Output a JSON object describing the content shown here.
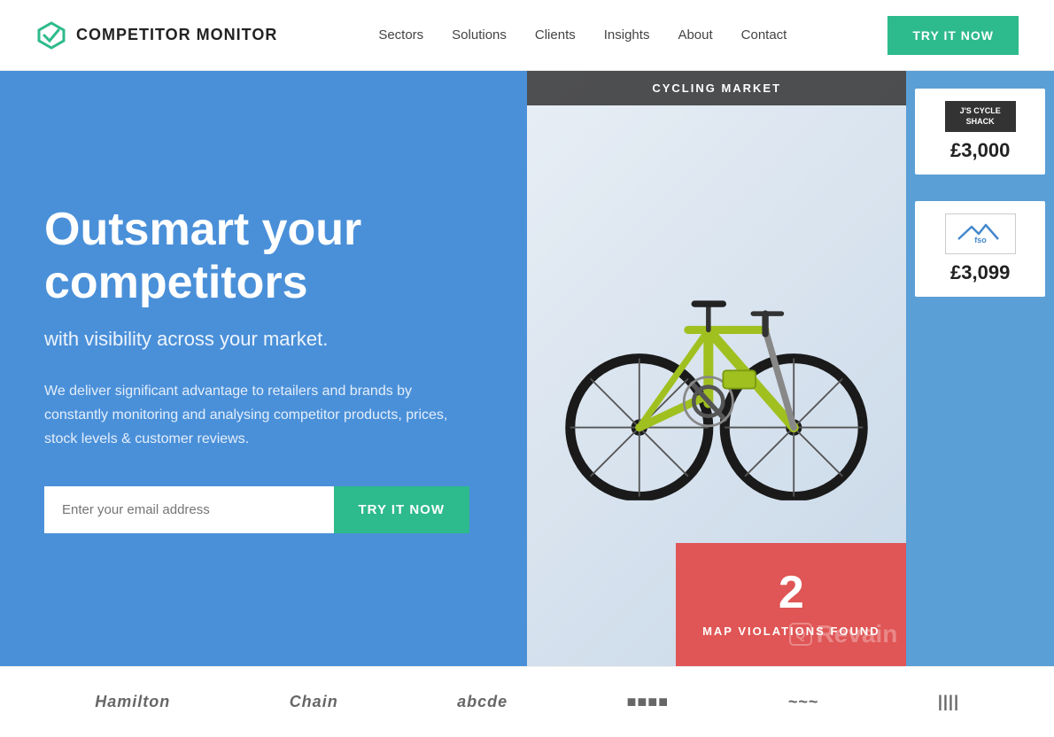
{
  "navbar": {
    "logo_text": "COMPETITOR MONITOR",
    "nav_items": [
      {
        "id": "sectors",
        "label": "Sectors"
      },
      {
        "id": "solutions",
        "label": "Solutions"
      },
      {
        "id": "clients",
        "label": "Clients"
      },
      {
        "id": "insights",
        "label": "Insights"
      },
      {
        "id": "about",
        "label": "About"
      },
      {
        "id": "contact",
        "label": "Contact"
      }
    ],
    "cta_label": "TRY IT NOW"
  },
  "hero": {
    "headline": "Outsmart your competitors",
    "subheadline": "with visibility across your market.",
    "body": "We deliver significant advantage to retailers and brands by constantly monitoring and analysing competitor products, prices, stock levels & customer reviews.",
    "email_placeholder": "Enter your email address",
    "cta_label": "TRY IT NOW"
  },
  "cycling_panel": {
    "badge": "CYCLING MARKET",
    "price1": {
      "logo_line1": "J'S CYCLE",
      "logo_line2": "SHACK",
      "price": "£3,000"
    },
    "price2": {
      "logo_text": "fso",
      "price": "£3,099"
    },
    "violations": {
      "number": "2",
      "text": "MAP VIOLATIONS FOUND"
    }
  },
  "brands": [
    {
      "id": "hamilton",
      "label": "Hamilton"
    },
    {
      "id": "chain",
      "label": "Chain"
    },
    {
      "id": "brand3",
      "label": "abcde"
    },
    {
      "id": "brand4",
      "label": "■■■■"
    },
    {
      "id": "brand5",
      "label": "~~~"
    },
    {
      "id": "brand6",
      "label": "||||"
    }
  ],
  "watermark": {
    "text": "Revain"
  },
  "colors": {
    "hero_bg": "#4a90d9",
    "cta_green": "#2dba8c",
    "violation_red": "#e05555",
    "sidebar_blue": "#5a9fd6"
  }
}
